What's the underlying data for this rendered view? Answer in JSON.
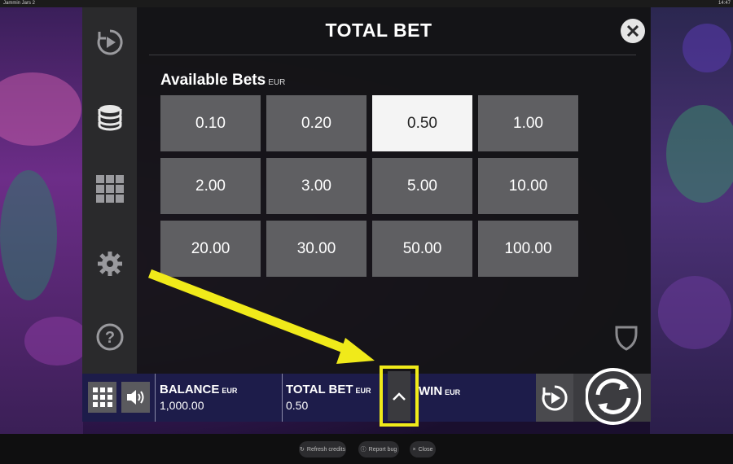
{
  "window": {
    "title": "Jammin Jars 2",
    "clock": "14:47"
  },
  "panel": {
    "title": "TOTAL BET",
    "available_label": "Available Bets",
    "available_unit": "EUR",
    "bets": [
      "0.10",
      "0.20",
      "0.50",
      "1.00",
      "2.00",
      "3.00",
      "5.00",
      "10.00",
      "20.00",
      "30.00",
      "50.00",
      "100.00"
    ],
    "selected_bet": "0.50"
  },
  "sidebar": {
    "icons": [
      "autoplay-icon",
      "coins-icon",
      "paytable-grid-icon",
      "settings-gear-icon",
      "help-icon"
    ]
  },
  "bottom": {
    "balance_label": "BALANCE",
    "balance_unit": "EUR",
    "balance_value": "1,000.00",
    "totalbet_label": "TOTAL BET",
    "totalbet_unit": "EUR",
    "totalbet_value": "0.50",
    "win_label": "WIN",
    "win_unit": "EUR"
  },
  "footer": {
    "refresh_label": "Refresh credits",
    "report_label": "Report bug",
    "close_label": "Close"
  },
  "colors": {
    "highlight": "#f0ea1a",
    "selected_bet_bg": "#f4f4f4",
    "bet_bg": "#5f5f62",
    "bottom_bar": "#1d1c4a"
  }
}
